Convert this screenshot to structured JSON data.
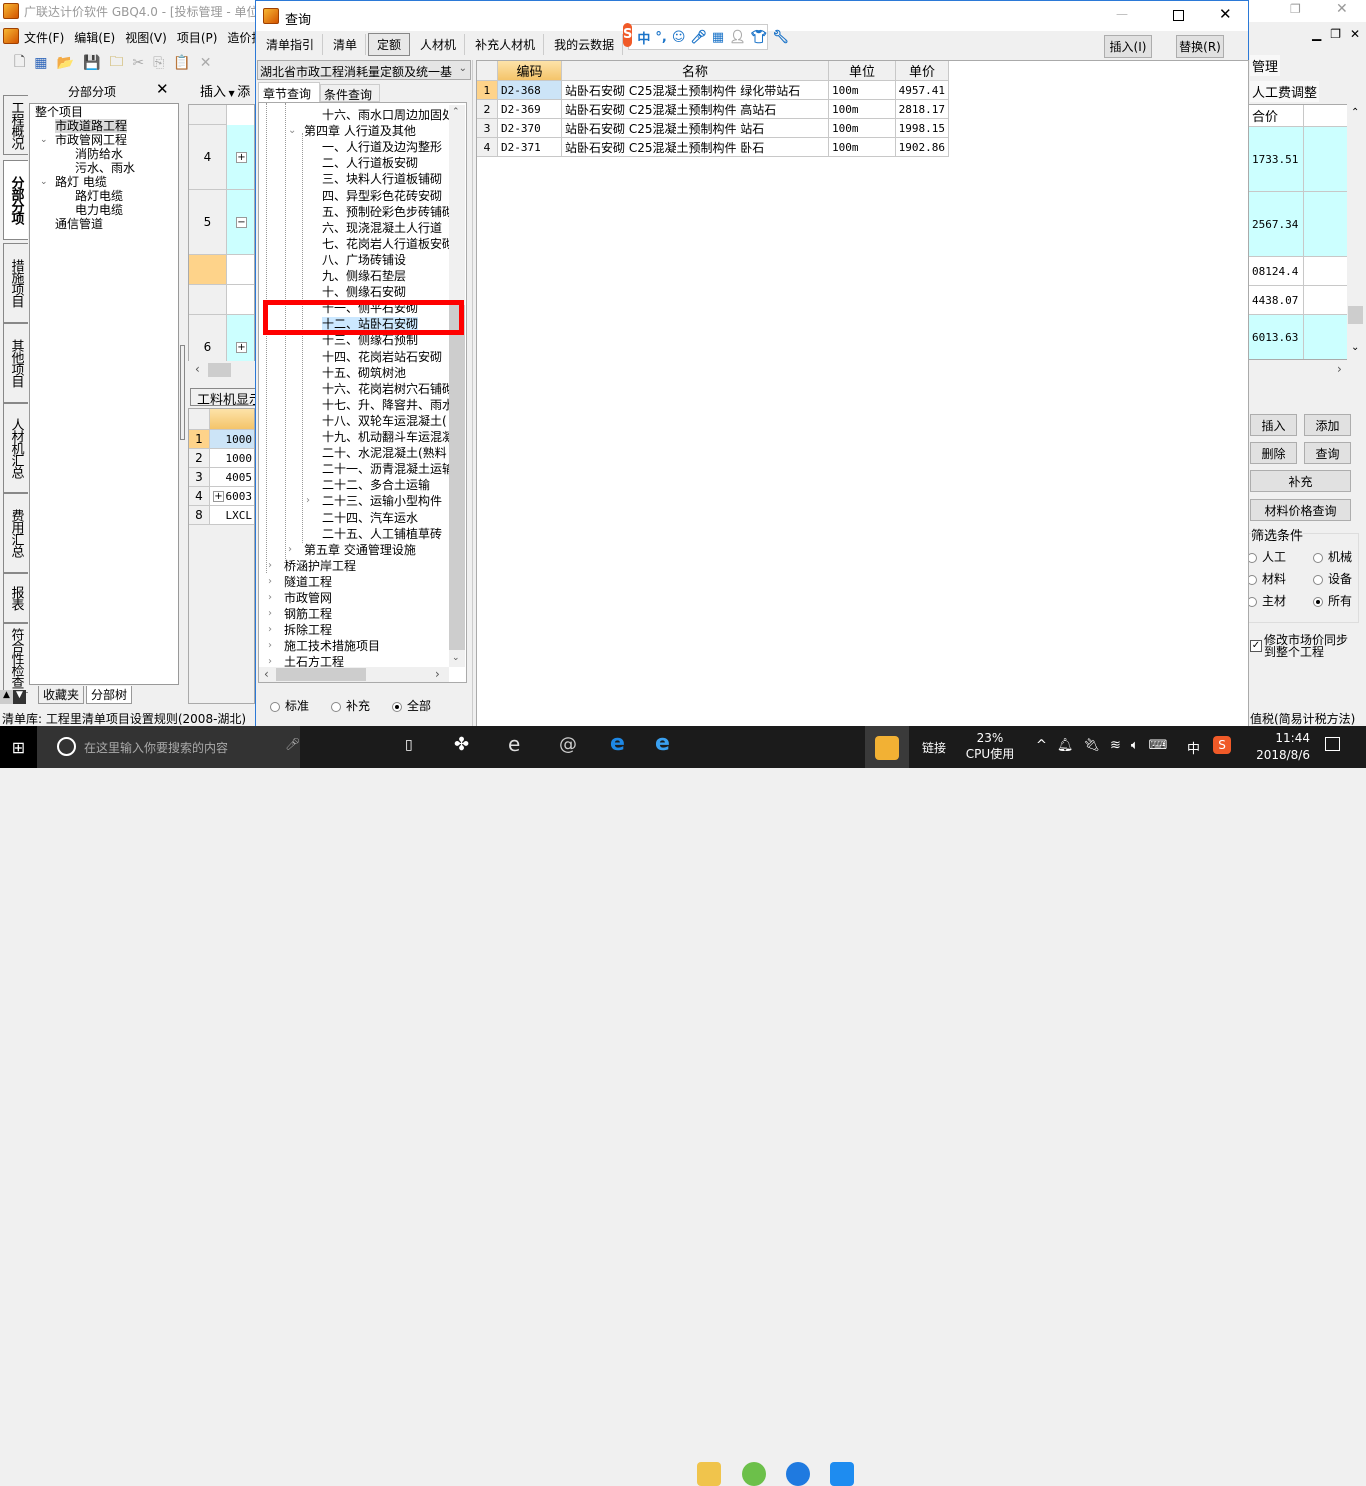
{
  "main_window": {
    "title": "广联达计价软件 GBQ4.0 - [投标管理 - 单位",
    "menu": [
      "文件(F)",
      "编辑(E)",
      "视图(V)",
      "项目(P)",
      "造价指"
    ],
    "vertical_tabs": [
      "工程概况",
      "分部分项",
      "措施项目",
      "其他项目",
      "人材机汇总",
      "费用汇总",
      "报表",
      "符合性检查"
    ],
    "tree_panel_title": "分部分项",
    "tree": [
      {
        "label": "整个项目",
        "level": 0
      },
      {
        "label": "市政道路工程",
        "level": 1,
        "selected": true
      },
      {
        "label": "市政管网工程",
        "level": 1,
        "expanded": true
      },
      {
        "label": "消防给水",
        "level": 2
      },
      {
        "label": "污水、雨水",
        "level": 2
      },
      {
        "label": "路灯 电缆",
        "level": 1,
        "expanded": true
      },
      {
        "label": "路灯电缆",
        "level": 2
      },
      {
        "label": "电力电缆",
        "level": 2
      },
      {
        "label": "通信管道",
        "level": 1
      }
    ],
    "tree_bottom_tabs": [
      "收藏夹",
      "分部树"
    ],
    "toolbar_insert": "插入",
    "toolbar_add_partial": "添",
    "grid_rows": [
      "4",
      "5",
      "",
      "",
      "6"
    ],
    "lower_tab": "工料机显示",
    "lower_rows": [
      {
        "no": "1",
        "code": "1000"
      },
      {
        "no": "2",
        "code": "1000"
      },
      {
        "no": "3",
        "code": "4005"
      },
      {
        "no": "4",
        "code": "6003"
      },
      {
        "no": "8",
        "code": "LXCL"
      }
    ],
    "status_left": "清单库: 工程里清单项目设置规则(2008-湖北)",
    "status_right": "值税(简易计税方法)",
    "right_tabs": [
      "管理",
      "人工费调整"
    ],
    "right_grid_header": "合价",
    "right_grid_values": [
      "1733.51",
      "2567.34",
      "08124.4",
      "4438.07",
      "6013.63"
    ],
    "right_buttons": {
      "insert": "插入",
      "add": "添加",
      "delete": "删除",
      "query": "查询",
      "supplement": "补充",
      "price_query": "材料价格查询"
    },
    "filter": {
      "title": "筛选条件",
      "options": [
        {
          "label": "人工",
          "checked": false
        },
        {
          "label": "机械",
          "checked": false
        },
        {
          "label": "材料",
          "checked": false
        },
        {
          "label": "设备",
          "checked": false
        },
        {
          "label": "主材",
          "checked": false
        },
        {
          "label": "所有",
          "checked": true
        }
      ]
    },
    "sync_checkbox": {
      "label": "修改市场价同步到整个工程",
      "checked": true
    }
  },
  "dialog": {
    "title": "查询",
    "tabs": [
      "清单指引",
      "清单",
      "定额",
      "人材机",
      "补充人材机",
      "我的云数据"
    ],
    "active_tab": "定额",
    "insert_button": "插入(I)",
    "replace_button": "替换(R)",
    "library_select": "湖北省市政工程消耗量定额及统一基",
    "sub_tabs": [
      "章节查询",
      "条件查询"
    ],
    "tree": [
      {
        "label": "十六、雨水口周边加固处",
        "level": 3
      },
      {
        "label": "第四章 人行道及其他",
        "level": 2,
        "expanded": true
      },
      {
        "label": "一、人行道及边沟整形",
        "level": 3
      },
      {
        "label": "二、人行道板安砌",
        "level": 3
      },
      {
        "label": "三、块料人行道板铺砌",
        "level": 3
      },
      {
        "label": "四、异型彩色花砖安砌",
        "level": 3
      },
      {
        "label": "五、预制砼彩色步砖铺砌",
        "level": 3
      },
      {
        "label": "六、现浇混凝土人行道",
        "level": 3
      },
      {
        "label": "七、花岗岩人行道板安砌",
        "level": 3
      },
      {
        "label": "八、广场砖铺设",
        "level": 3
      },
      {
        "label": "九、侧缘石垫层",
        "level": 3
      },
      {
        "label": "十、侧缘石安砌",
        "level": 3
      },
      {
        "label": "十一、侧平石安砌",
        "level": 3
      },
      {
        "label": "十二、站卧石安砌",
        "level": 3,
        "selected": true
      },
      {
        "label": "十三、侧缘石预制",
        "level": 3
      },
      {
        "label": "十四、花岗岩站石安砌",
        "level": 3
      },
      {
        "label": "十五、砌筑树池",
        "level": 3
      },
      {
        "label": "十六、花岗岩树穴石铺砌",
        "level": 3
      },
      {
        "label": "十七、升、降窨井、雨水",
        "level": 3
      },
      {
        "label": "十八、双轮车运混凝土(",
        "level": 3
      },
      {
        "label": "十九、机动翻斗车运混凝",
        "level": 3
      },
      {
        "label": "二十、水泥混凝土(熟料",
        "level": 3
      },
      {
        "label": "二十一、沥青混凝土运输",
        "level": 3
      },
      {
        "label": "二十二、多合土运输",
        "level": 3
      },
      {
        "label": "二十三、运输小型构件",
        "level": 3,
        "collapsed": true
      },
      {
        "label": "二十四、汽车运水",
        "level": 3
      },
      {
        "label": "二十五、人工铺植草砖",
        "level": 3
      },
      {
        "label": "第五章 交通管理设施",
        "level": 2,
        "collapsed": true
      },
      {
        "label": "桥涵护岸工程",
        "level": 0,
        "collapsed": true
      },
      {
        "label": "隧道工程",
        "level": 0,
        "collapsed": true
      },
      {
        "label": "市政管网",
        "level": 0,
        "collapsed": true
      },
      {
        "label": "钢筋工程",
        "level": 0,
        "collapsed": true
      },
      {
        "label": "拆除工程",
        "level": 0,
        "collapsed": true
      },
      {
        "label": "施工技术措施项目",
        "level": 0,
        "collapsed": true
      },
      {
        "label": "土石方工程",
        "level": 0,
        "collapsed": true
      }
    ],
    "radio_options": [
      {
        "label": "标准",
        "checked": false
      },
      {
        "label": "补充",
        "checked": false
      },
      {
        "label": "全部",
        "checked": true
      }
    ],
    "table": {
      "columns": [
        "编码",
        "名称",
        "单位",
        "单价"
      ],
      "rows": [
        {
          "no": "1",
          "code": "D2-368",
          "name": "站卧石安砌 C25混凝土预制构件 绿化带站石",
          "unit": "100m",
          "price": "4957.41"
        },
        {
          "no": "2",
          "code": "D2-369",
          "name": "站卧石安砌 C25混凝土预制构件 高站石",
          "unit": "100m",
          "price": "2818.17"
        },
        {
          "no": "3",
          "code": "D2-370",
          "name": "站卧石安砌 C25混凝土预制构件 站石",
          "unit": "100m",
          "price": "1998.15"
        },
        {
          "no": "4",
          "code": "D2-371",
          "name": "站卧石安砌 C25混凝土预制构件 卧石",
          "unit": "100m",
          "price": "1902.86"
        }
      ]
    }
  },
  "ime_toolbar": {
    "mode": "中",
    "punct": "°,"
  },
  "taskbar": {
    "search_placeholder": "在这里输入你要搜索的内容",
    "link_label": "链接",
    "cpu_percent": "23%",
    "cpu_label": "CPU使用",
    "ime": "中",
    "time": "11:44",
    "date": "2018/8/6"
  },
  "colors": {
    "header_orange": "#f8d38a",
    "teal_row": "#ccffff",
    "selection": "#cce4f7",
    "highlight_box": "#ff0000",
    "taskbar": "#1b1b1b"
  }
}
